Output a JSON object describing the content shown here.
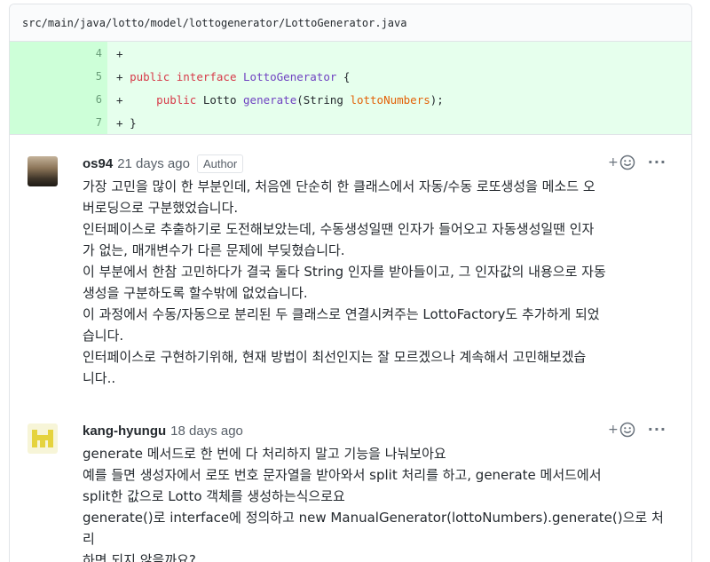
{
  "file": {
    "path": "src/main/java/lotto/model/lottogenerator/LottoGenerator.java"
  },
  "diff": {
    "lines": [
      {
        "num": "4",
        "plus": "+",
        "parts": []
      },
      {
        "num": "5",
        "plus": "+",
        "parts": [
          {
            "t": "public",
            "c": "kw"
          },
          {
            "t": " ",
            "c": ""
          },
          {
            "t": "interface",
            "c": "kw"
          },
          {
            "t": " ",
            "c": ""
          },
          {
            "t": "LottoGenerator",
            "c": "nm"
          },
          {
            "t": " {",
            "c": ""
          }
        ]
      },
      {
        "num": "6",
        "plus": "+",
        "parts": [
          {
            "t": "    ",
            "c": ""
          },
          {
            "t": "public",
            "c": "kw"
          },
          {
            "t": " Lotto ",
            "c": ""
          },
          {
            "t": "generate",
            "c": "nm"
          },
          {
            "t": "(String ",
            "c": ""
          },
          {
            "t": "lottoNumbers",
            "c": "pr"
          },
          {
            "t": ");",
            "c": ""
          }
        ]
      },
      {
        "num": "7",
        "plus": "+",
        "parts": [
          {
            "t": "}",
            "c": ""
          }
        ]
      }
    ]
  },
  "comments": [
    {
      "author": "os94",
      "time": "21 days ago",
      "badge": "Author",
      "body": [
        "가장 고민을 많이 한 부분인데, 처음엔 단순히 한 클래스에서 자동/수동 로또생성을 메소드 오",
        "버로딩으로 구분했었습니다.",
        "인터페이스로 추출하기로 도전해보았는데, 수동생성일땐 인자가 들어오고 자동생성일땐 인자",
        "가 없는, 매개변수가 다른 문제에 부딪혔습니다.",
        "이 부분에서 한참 고민하다가 결국 둘다 String 인자를 받아들이고, 그 인자값의 내용으로 자동",
        "생성을 구분하도록 할수밖에 없었습니다.",
        "이 과정에서 수동/자동으로 분리된 두 클래스로 연결시켜주는 LottoFactory도 추가하게 되었",
        "습니다.",
        "인터페이스로 구현하기위해, 현재 방법이 최선인지는 잘 모르겠으나 계속해서 고민해보겠습",
        "니다.."
      ]
    },
    {
      "author": "kang-hyungu",
      "time": "18 days ago",
      "badge": "",
      "body": [
        "generate 메서드로 한 번에 다 처리하지 말고 기능을 나눠보아요",
        "예를 들면 생성자에서 로또 번호 문자열을 받아와서 split 처리를 하고, generate 메서드에서",
        "split한 값으로 Lotto 객체를 생성하는식으로요",
        "generate()로 interface에 정의하고 new ManualGenerator(lottoNumbers).generate()으로 처리",
        "하면 되지 않을까요?"
      ]
    }
  ],
  "actions": {
    "reaction_plus": "+",
    "more": "···"
  },
  "colors": {
    "diff_bg": "#e6ffed",
    "diff_num_bg": "#cdffd8",
    "keyword": "#d73a49",
    "name": "#6f42c1",
    "param": "#e36209"
  }
}
